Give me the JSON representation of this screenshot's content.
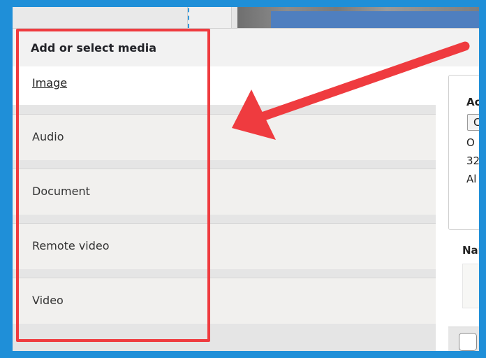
{
  "modal": {
    "title": "Add or select media"
  },
  "media_types": [
    {
      "label": "Image",
      "active": true
    },
    {
      "label": "Audio",
      "active": false
    },
    {
      "label": "Document",
      "active": false
    },
    {
      "label": "Remote video",
      "active": false
    },
    {
      "label": "Video",
      "active": false
    }
  ],
  "right_panel": {
    "heading_partial": "Ac",
    "button_partial": "C",
    "line1_partial": "O",
    "line2_partial": "32",
    "line3_partial": "Al",
    "name_label_partial": "Nam"
  },
  "annotation": {
    "color": "#ef3b3f",
    "frame_color": "#1f8fd8"
  },
  "icons": {
    "arrow": "arrow-pointing-left-icon"
  }
}
